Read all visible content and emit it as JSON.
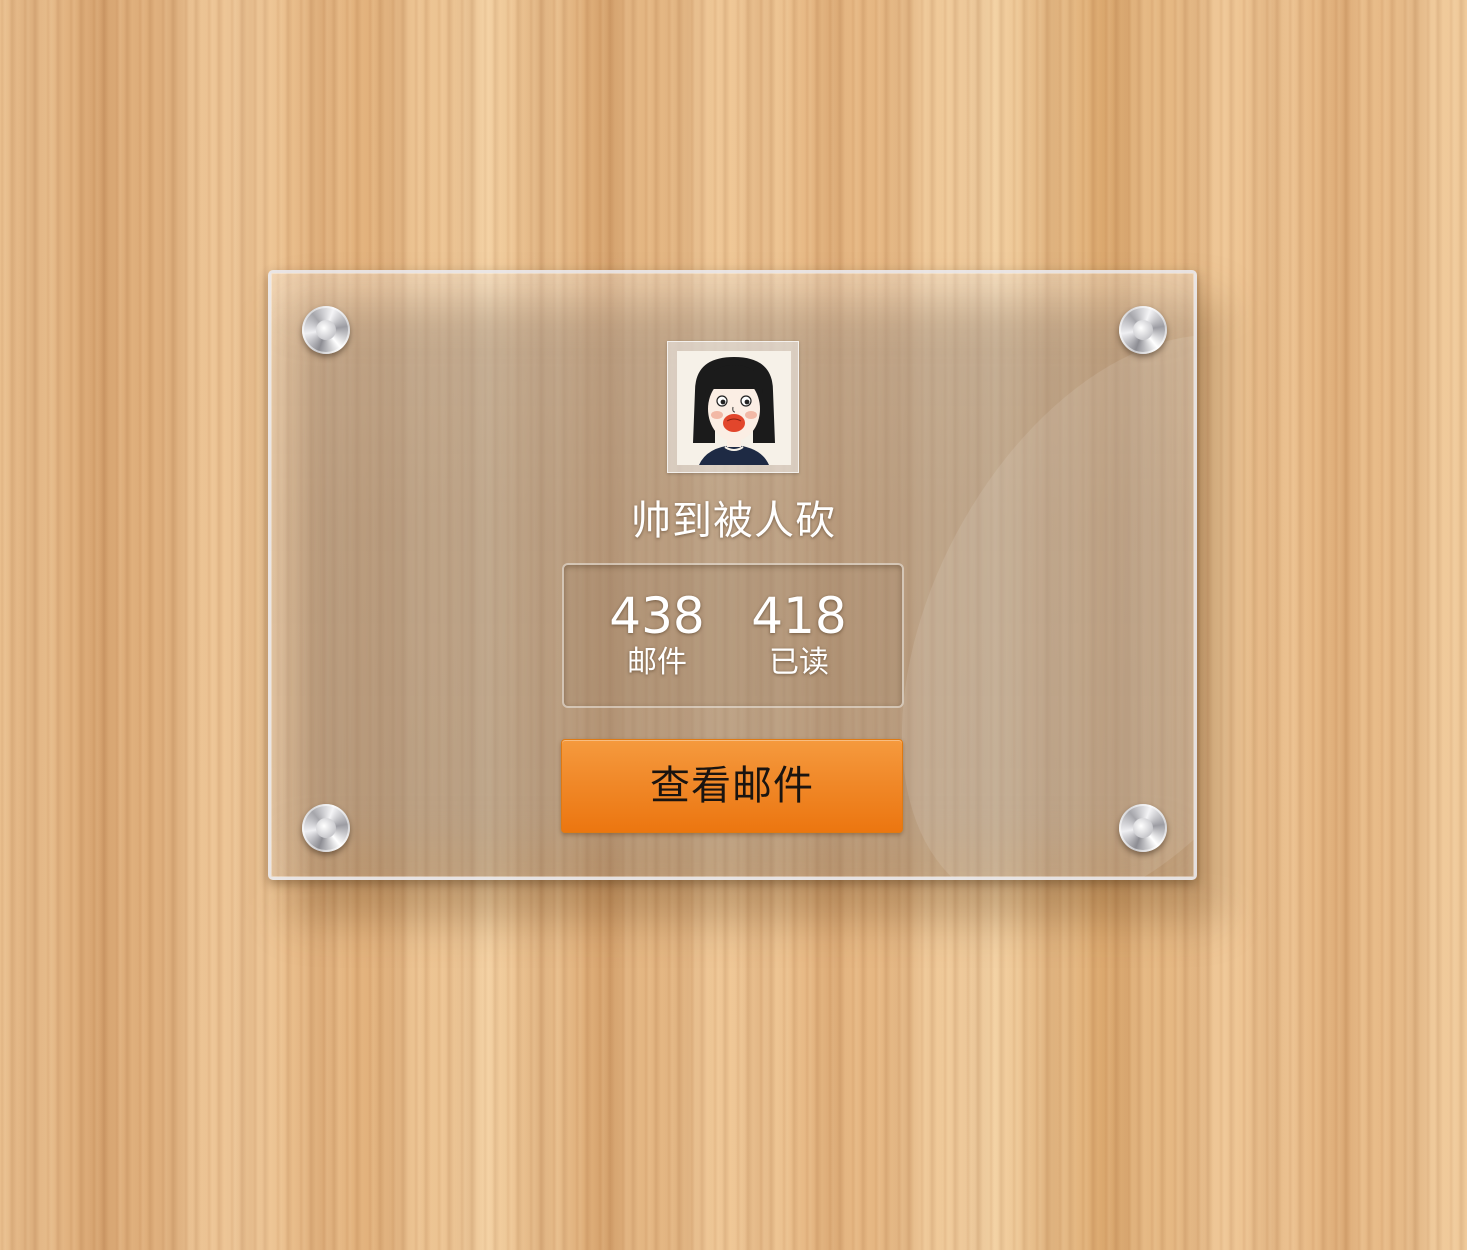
{
  "profile": {
    "username": "帅到被人砍",
    "avatar_icon": "cartoon-girl-avatar"
  },
  "stats": {
    "mail_count": "438",
    "mail_label": "邮件",
    "read_count": "418",
    "read_label": "已读"
  },
  "actions": {
    "view_mail_label": "查看邮件",
    "button_color": "#f08727"
  },
  "decor": {
    "bolt_icon": "metal-bolt-icon",
    "background": "wood-grain"
  }
}
